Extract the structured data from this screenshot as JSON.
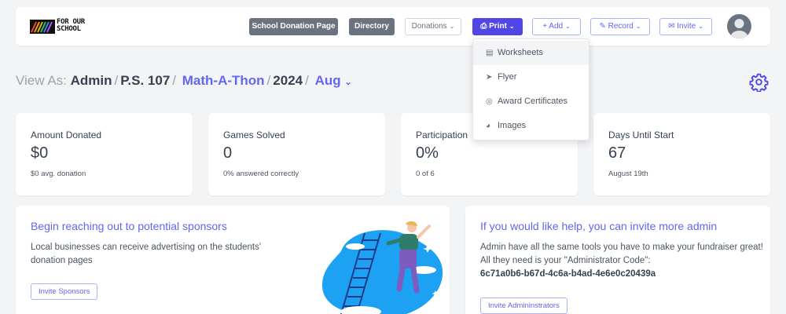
{
  "header": {
    "logo_text_line1": "FOR OUR",
    "logo_text_line2": "SCHOOL",
    "donation_page_btn": "School Donation Page",
    "directory_btn": "Directory",
    "donations_btn": "Donations",
    "print_btn": "Print",
    "add_btn": "Add",
    "record_btn": "Record",
    "invite_btn": "Invite"
  },
  "print_menu": {
    "items": [
      {
        "label": "Worksheets",
        "icon": "document-icon"
      },
      {
        "label": "Flyer",
        "icon": "paper-plane-icon"
      },
      {
        "label": "Award Certificates",
        "icon": "medal-icon"
      },
      {
        "label": "Images",
        "icon": "palette-icon"
      }
    ]
  },
  "view_as": {
    "label": "View As:",
    "role": "Admin",
    "school": "P.S. 107",
    "event": "Math-A-Thon",
    "year": "2024",
    "month": "Aug"
  },
  "stats": [
    {
      "label": "Amount Donated",
      "value": "$0",
      "sub": "$0 avg. donation"
    },
    {
      "label": "Games Solved",
      "value": "0",
      "sub": "0% answered correctly"
    },
    {
      "label": "Participation",
      "value": "0%",
      "sub": "0 of 6"
    },
    {
      "label": "Days Until Start",
      "value": "67",
      "sub": "August 19th"
    }
  ],
  "sponsors_card": {
    "title": "Begin reaching out to potential sponsors",
    "text": "Local businesses can receive advertising on the students' donation pages",
    "button": "Invite Sponsors"
  },
  "admin_card": {
    "title": "If you would like help, you can invite more admin",
    "text": "Admin have all the same tools you have to make your fundraiser great! All they need is your \"Administrator Code\":",
    "code": "6c71a0b6-b67d-4c6a-b4ad-4e6e0c20439a",
    "button": "Invite Admininstrators"
  },
  "colors": {
    "accent": "#4f46e5",
    "accent_light": "#6366f1",
    "gray_button": "#6b7280",
    "background": "#f3f4f6"
  }
}
